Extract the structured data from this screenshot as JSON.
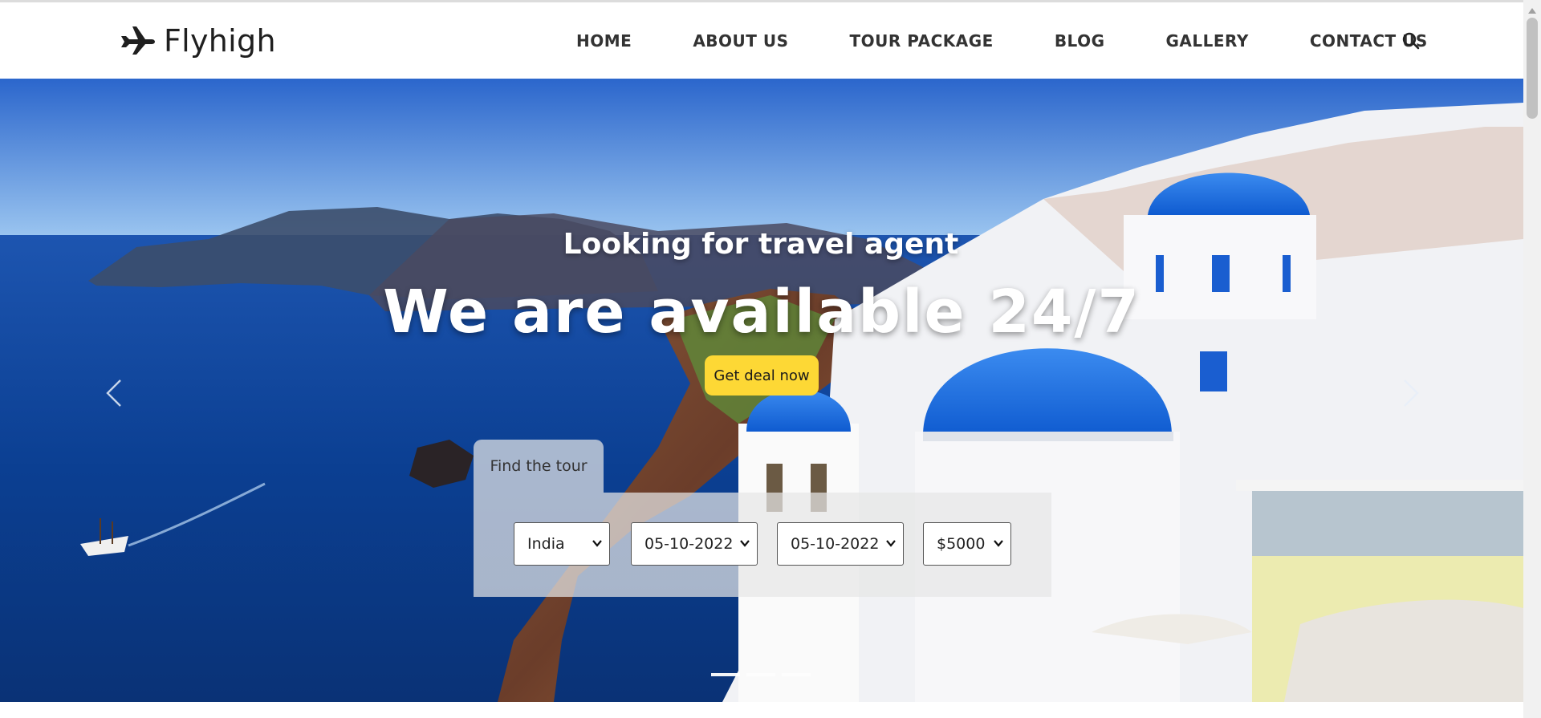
{
  "brand": {
    "name": "Flyhigh",
    "logo_icon": "airplane-icon"
  },
  "nav": {
    "items": [
      {
        "label": "HOME"
      },
      {
        "label": "ABOUT US"
      },
      {
        "label": "TOUR PACKAGE"
      },
      {
        "label": "BLOG"
      },
      {
        "label": "GALLERY"
      },
      {
        "label": "CONTACT US"
      }
    ],
    "search_icon": "search-icon"
  },
  "hero": {
    "subtitle": "Looking for travel agent",
    "title": "We are available 24/7",
    "cta_label": "Get deal now",
    "cta_color": "#fdd835",
    "prev_icon": "chevron-left-icon",
    "next_icon": "chevron-right-icon",
    "slides_count": 3,
    "active_slide": 1
  },
  "finder": {
    "tab_label": "Find the tour",
    "country": "India",
    "date_from": "05-10-2022",
    "date_to": "05-10-2022",
    "budget": "$5000"
  }
}
